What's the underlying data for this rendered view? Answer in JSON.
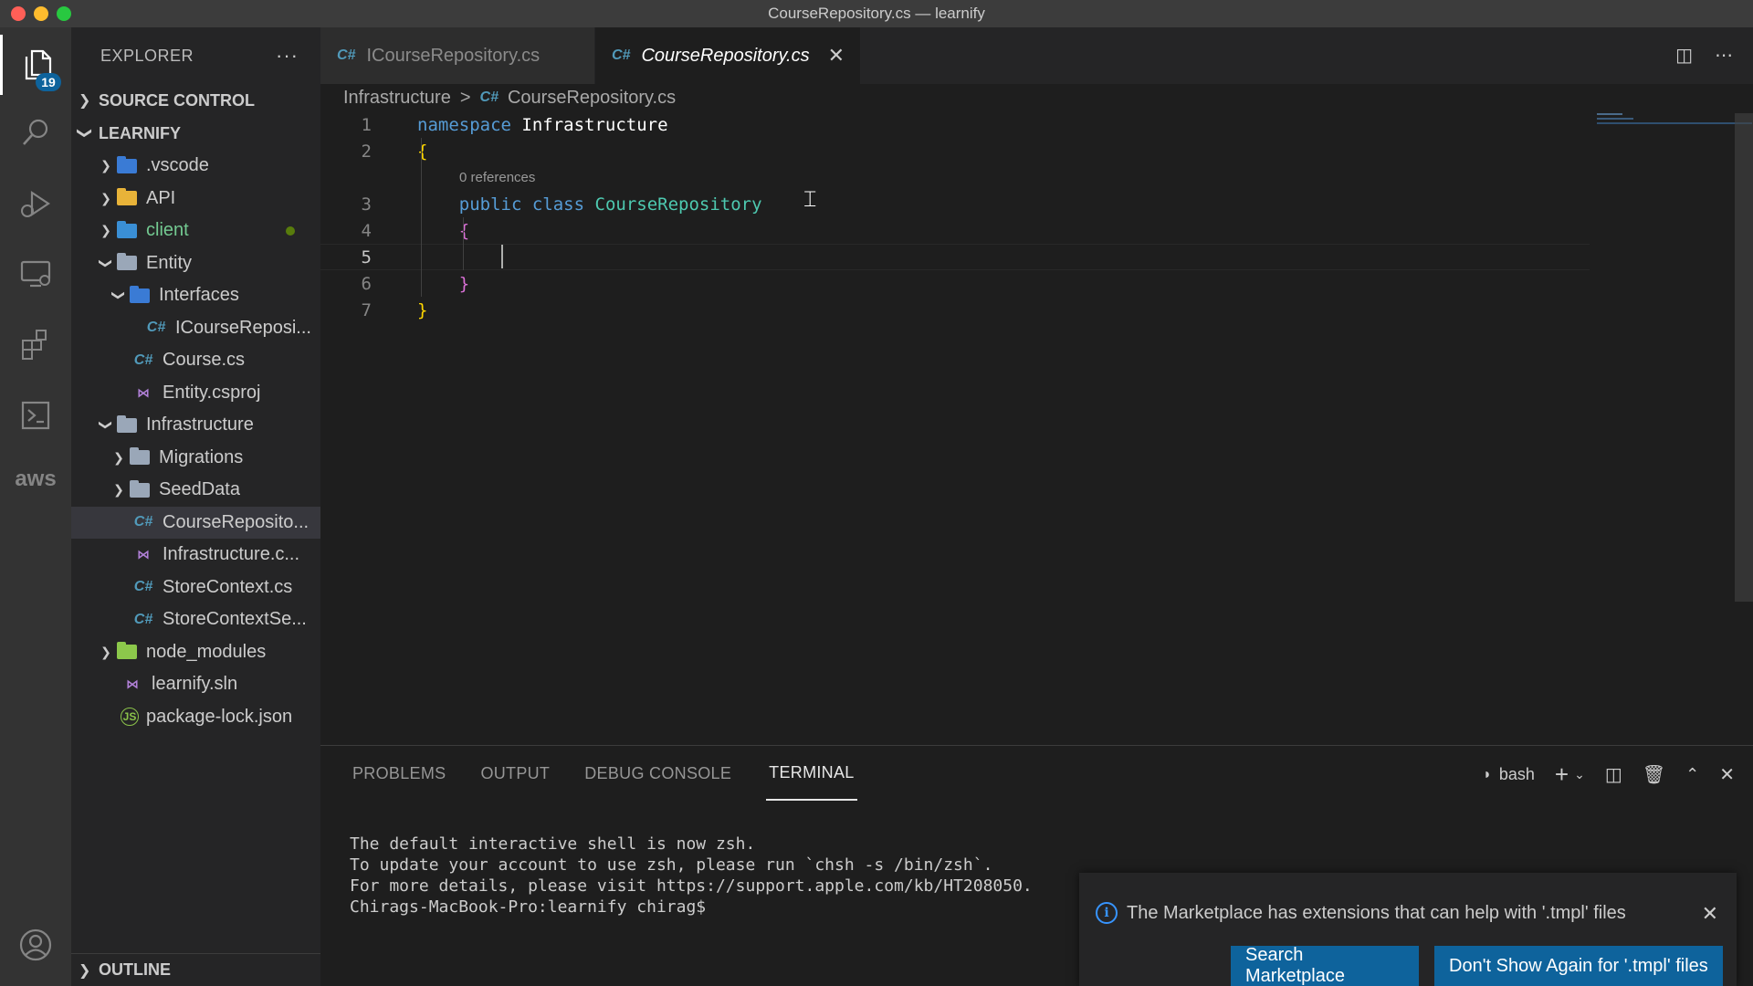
{
  "window": {
    "title": "CourseRepository.cs — learnify"
  },
  "activity_bar": {
    "explorer_badge": "19",
    "aws_label": "aws"
  },
  "sidebar": {
    "title": "EXPLORER",
    "more": "···",
    "source_control": "SOURCE CONTROL",
    "project": "LEARNIFY",
    "outline": "OUTLINE",
    "tree": [
      {
        "label": ".vscode"
      },
      {
        "label": "API"
      },
      {
        "label": "client"
      },
      {
        "label": "Entity"
      },
      {
        "label": "Interfaces"
      },
      {
        "label": "ICourseReposi..."
      },
      {
        "label": "Course.cs"
      },
      {
        "label": "Entity.csproj"
      },
      {
        "label": "Infrastructure"
      },
      {
        "label": "Migrations"
      },
      {
        "label": "SeedData"
      },
      {
        "label": "CourseReposito..."
      },
      {
        "label": "Infrastructure.c..."
      },
      {
        "label": "StoreContext.cs"
      },
      {
        "label": "StoreContextSe..."
      },
      {
        "label": "node_modules"
      },
      {
        "label": "learnify.sln"
      },
      {
        "label": "package-lock.json"
      }
    ]
  },
  "tabs": [
    {
      "label": "ICourseRepository.cs",
      "lang": "C#"
    },
    {
      "label": "CourseRepository.cs",
      "lang": "C#",
      "close": "✕"
    }
  ],
  "breadcrumb": {
    "folder": "Infrastructure",
    "sep": ">",
    "lang": "C#",
    "file": "CourseRepository.cs"
  },
  "editor": {
    "codelens": "0 references",
    "line_numbers": [
      "1",
      "2",
      "3",
      "4",
      "5",
      "6",
      "7"
    ],
    "tokens": {
      "kw_namespace": "namespace",
      "ns_name": "Infrastructure",
      "open_brace": "{",
      "kw_public": "public",
      "kw_class": "class",
      "class_name": "CourseRepository",
      "inner_open": "{",
      "inner_close": "}",
      "close_brace": "}"
    }
  },
  "panel": {
    "tabs": [
      "PROBLEMS",
      "OUTPUT",
      "DEBUG CONSOLE",
      "TERMINAL"
    ],
    "shell": "bash",
    "terminal_lines": [
      "The default interactive shell is now zsh.",
      "To update your account to use zsh, please run `chsh -s /bin/zsh`.",
      "For more details, please visit https://support.apple.com/kb/HT208050.",
      "Chirags-MacBook-Pro:learnify chirag$ "
    ]
  },
  "notification": {
    "message": "The Marketplace has extensions that can help with '.tmpl' files",
    "buttons": [
      "Search Marketplace",
      "Don't Show Again for '.tmpl' files"
    ]
  },
  "colors": {
    "accent": "#0e639c",
    "keyword": "#569cd6",
    "class": "#4ec9b0",
    "brace_outer": "#ffd700",
    "brace_inner": "#da70d6"
  }
}
